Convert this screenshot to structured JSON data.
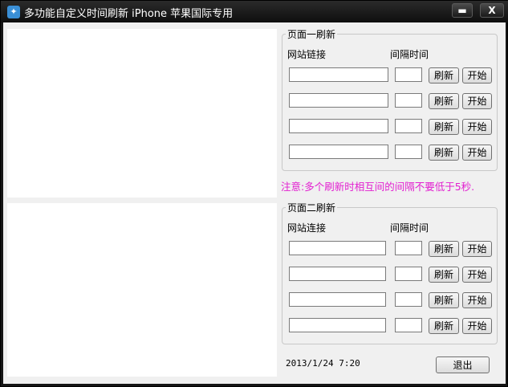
{
  "window": {
    "title": "多功能自定义时间刷新 iPhone 苹果国际专用",
    "minimize_glyph": "▬",
    "close_glyph": "X",
    "app_icon_glyph": "✦"
  },
  "page1": {
    "legend": "页面一刷新",
    "url_header": "网站链接",
    "interval_header": "间隔时间",
    "rows": [
      {
        "url": "",
        "interval": "",
        "refresh_label": "刷新",
        "start_label": "开始"
      },
      {
        "url": "",
        "interval": "",
        "refresh_label": "刷新",
        "start_label": "开始"
      },
      {
        "url": "",
        "interval": "",
        "refresh_label": "刷新",
        "start_label": "开始"
      },
      {
        "url": "",
        "interval": "",
        "refresh_label": "刷新",
        "start_label": "开始"
      }
    ]
  },
  "note": "注意:多个刷新时相互间的间隔不要低于5秒.",
  "page2": {
    "legend": "页面二刷新",
    "url_header": "网站连接",
    "interval_header": "间隔时间",
    "rows": [
      {
        "url": "",
        "interval": "",
        "refresh_label": "刷新",
        "start_label": "开始"
      },
      {
        "url": "",
        "interval": "",
        "refresh_label": "刷新",
        "start_label": "开始"
      },
      {
        "url": "",
        "interval": "",
        "refresh_label": "刷新",
        "start_label": "开始"
      },
      {
        "url": "",
        "interval": "",
        "refresh_label": "刷新",
        "start_label": "开始"
      }
    ]
  },
  "status": {
    "datetime": "2013/1/24 7:20"
  },
  "exit_label": "退出"
}
